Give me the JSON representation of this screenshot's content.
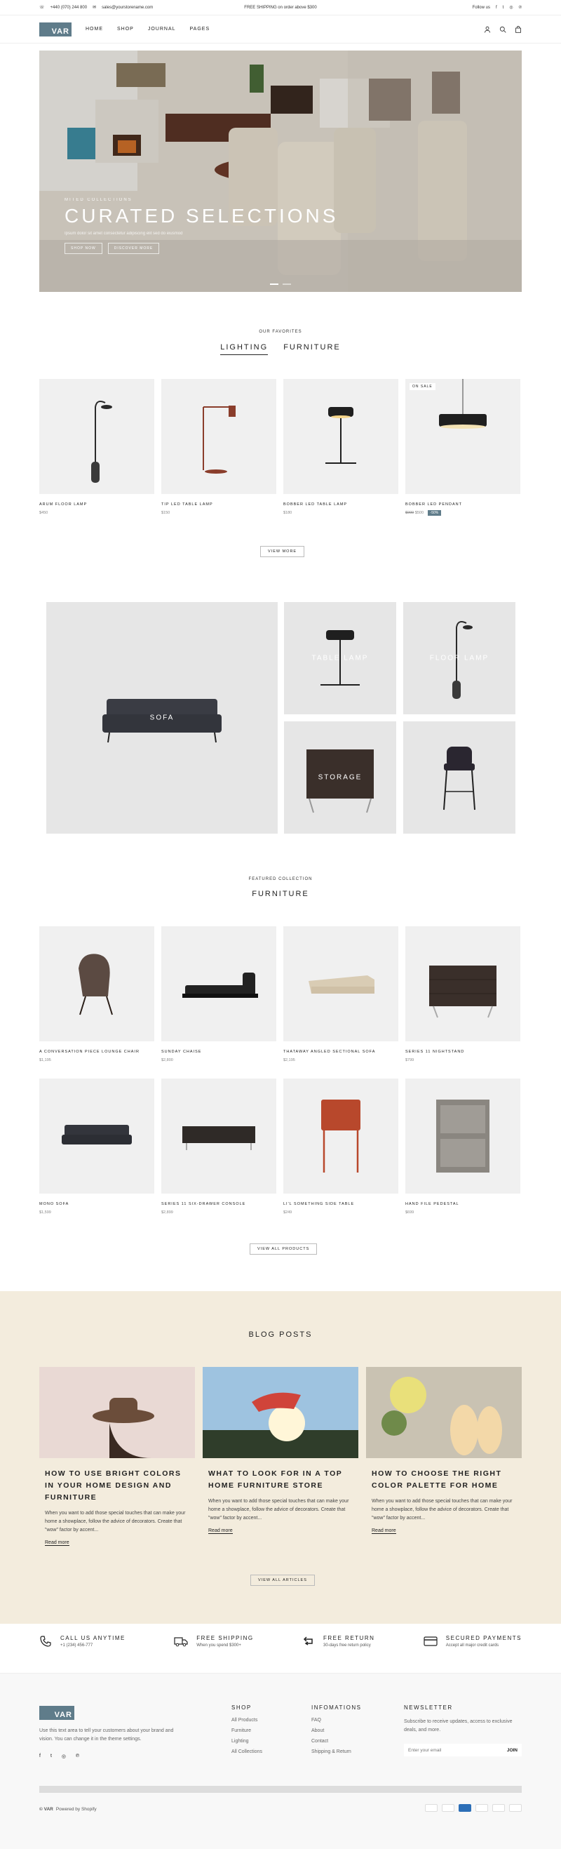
{
  "topbar": {
    "phone": "+440 (070) 244 800",
    "email": "sales@yourstorename.com",
    "promo": "FREE SHIPPING on order above $300",
    "follow": "Follow us"
  },
  "header": {
    "logo": "VAR",
    "menu": [
      "HOME",
      "SHOP",
      "JOURNAL",
      "PAGES"
    ]
  },
  "hero": {
    "subtitle": "MITED COLLECTIONS",
    "title": "CURATED SELECTIONS",
    "description": "Ipsum dolor sit amet consectetur adipiscing elit sed do eiusmod",
    "button1": "SHOP NOW",
    "button2": "DISCOVER MORE"
  },
  "favorites": {
    "label": "OUR FAVORITES",
    "tabs": [
      "LIGHTING",
      "FURNITURE"
    ],
    "products": [
      {
        "name": "ARUM FLOOR LAMP",
        "price": "$450"
      },
      {
        "name": "TIP LED TABLE LAMP",
        "price": "$150"
      },
      {
        "name": "BOBBER LED TABLE LAMP",
        "price": "$180"
      },
      {
        "name": "BOBBER LED PENDANT",
        "old_price": "$999",
        "price": "$500",
        "sale": "-50%",
        "badge": "ON SALE"
      }
    ],
    "view_more": "VIEW MORE"
  },
  "collections": [
    "SOFA",
    "TABLE LAMP",
    "FLOOR LAMP",
    "STORAGE"
  ],
  "featured": {
    "label": "FEATURED COLLECTION",
    "title": "FURNITURE",
    "products": [
      {
        "name": "A CONVERSATION PIECE LOUNGE CHAIR",
        "price": "$1,195"
      },
      {
        "name": "SUNDAY CHAISE",
        "price": "$2,800"
      },
      {
        "name": "THATAWAY ANGLED SECTIONAL SOFA",
        "price": "$2,195"
      },
      {
        "name": "SERIES 11 NIGHTSTAND",
        "price": "$799"
      },
      {
        "name": "MONO SOFA",
        "price": "$1,599"
      },
      {
        "name": "SERIES 11 SIX-DRAWER CONSOLE",
        "price": "$2,899"
      },
      {
        "name": "LI'L SOMETHING SIDE TABLE",
        "price": "$249"
      },
      {
        "name": "HAND FILE PEDESTAL",
        "price": "$699"
      }
    ],
    "view_all": "VIEW ALL PRODUCTS"
  },
  "blog": {
    "title": "BLOG POSTS",
    "posts": [
      {
        "title": "HOW TO USE BRIGHT COLORS IN YOUR HOME DESIGN AND FURNITURE",
        "excerpt": "When you want to add those special touches that can make your home a showplace, follow the advice of decorators. Create that \"wow\" factor by accent...",
        "more": "Read more"
      },
      {
        "title": "WHAT TO LOOK FOR IN A TOP HOME FURNITURE STORE",
        "excerpt": "When you want to add those special touches that can make your home a showplace, follow the advice of decorators. Create that \"wow\" factor by accent...",
        "more": "Read more"
      },
      {
        "title": "HOW TO CHOOSE THE RIGHT COLOR PALETTE FOR HOME",
        "excerpt": "When you want to add those special touches that can make your home a showplace, follow the advice of decorators. Create that \"wow\" factor by accent...",
        "more": "Read more"
      }
    ],
    "view_all": "VIEW ALL ARTICLES"
  },
  "features": [
    {
      "title": "CALL US ANYTIME",
      "sub": "+1 (234) 456-777"
    },
    {
      "title": "FREE SHIPPING",
      "sub": "When you spend $300+"
    },
    {
      "title": "FREE RETURN",
      "sub": "30-days free return policy"
    },
    {
      "title": "SECURED PAYMENTS",
      "sub": "Accept all major credit cards"
    }
  ],
  "footer": {
    "logo": "VAR",
    "about": "Use this text area to tell your customers about your brand and vision. You can change it in the theme settings.",
    "shop_title": "SHOP",
    "shop_links": [
      "All Products",
      "Furniture",
      "Lighting",
      "All Collections"
    ],
    "info_title": "INFOMATIONS",
    "info_links": [
      "FAQ",
      "About",
      "Contact",
      "Shipping & Return"
    ],
    "newsletter_title": "NEWSLETTER",
    "newsletter_text": "Subscribe to receive updates, access to exclusive deals, and more.",
    "email_placeholder": "Enter your email",
    "join": "JOIN",
    "copyright": "© VAR",
    "powered": "Powered by Shopify"
  }
}
